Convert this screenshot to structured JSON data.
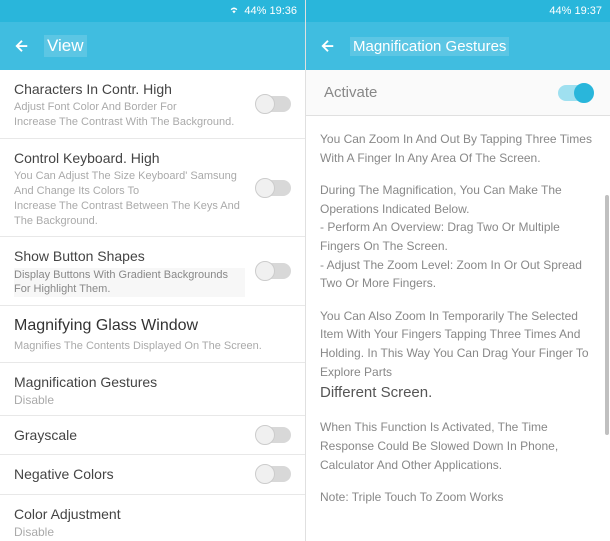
{
  "left": {
    "status": {
      "battery_text": "44% 19:36"
    },
    "header": {
      "title": "View"
    },
    "items": [
      {
        "title": "Characters In Contr. High",
        "desc1": "Adjust Font Color And Border For",
        "desc2": "Increase The Contrast With The Background."
      },
      {
        "title": "Control Keyboard. High",
        "desc1": "You Can Adjust The Size Keyboard' Samsung And Change Its Colors To",
        "desc2": "Increase The Contrast Between The Keys And The Background."
      },
      {
        "title": "Show Button Shapes",
        "desc1": "Display Buttons With Gradient Backgrounds For Highlight Them."
      },
      {
        "title": "Magnifying Glass Window",
        "desc1": "Magnifies The Contents Displayed On The Screen."
      },
      {
        "title": "Magnification Gestures",
        "status": "Disable"
      },
      {
        "title": "Grayscale"
      },
      {
        "title": "Negative Colors"
      },
      {
        "title": "Color Adjustment",
        "status": "Disable"
      }
    ]
  },
  "right": {
    "status": {
      "battery_text": "44% 19:37"
    },
    "header": {
      "title": "Magnification Gestures"
    },
    "activate": {
      "label": "Activate"
    },
    "info": {
      "p1": "You Can Zoom In And Out By Tapping Three Times With A Finger In Any Area Of The Screen.",
      "p2a": "During The Magnification, You Can Make The Operations Indicated Below.",
      "p2b": "- Perform An Overview: Drag Two Or Multiple Fingers On The Screen.",
      "p2c": "- Adjust The Zoom Level: Zoom In Or Out Spread Two Or More Fingers.",
      "p3a": "You Can Also Zoom In Temporarily The Selected Item With Your Fingers Tapping Three Times And Holding. In This Way You Can Drag Your Finger To Explore Parts",
      "p3b": "Different Screen.",
      "p4": "When This Function Is Activated, The Time Response Could Be Slowed Down In Phone, Calculator And Other Applications.",
      "p5": "Note: Triple Touch To Zoom Works"
    }
  }
}
